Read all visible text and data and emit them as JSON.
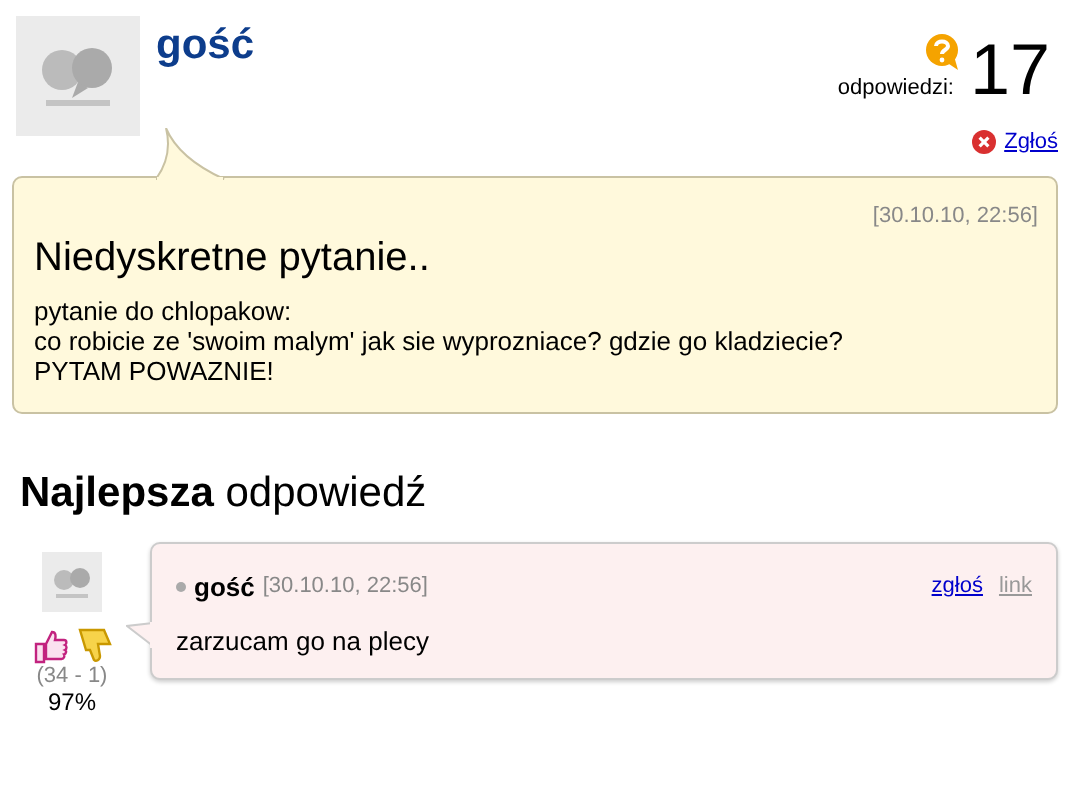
{
  "question": {
    "author": "gość",
    "answers_label": "odpowiedzi:",
    "answers_count": "17",
    "report_link": "Zgłoś",
    "date": "[30.10.10, 22:56]",
    "title": "Niedyskretne pytanie..",
    "body_lines": [
      "pytanie do chlopakow:",
      "co robicie ze 'swoim malym' jak sie wyprozniace? gdzie go kladziecie?",
      "PYTAM POWAZNIE!"
    ]
  },
  "best_answer": {
    "heading": "**Najlepsza** odpowiedź",
    "author": "gość",
    "date": "[30.10.10, 22:56]",
    "links": [
      {
        "label": "zgłoś",
        "kind": "report"
      },
      {
        "label": "link",
        "kind": "permalink"
      }
    ],
    "text": "zarzucam go na plecy",
    "votes": "(34 - 1)",
    "percent": "97%"
  }
}
